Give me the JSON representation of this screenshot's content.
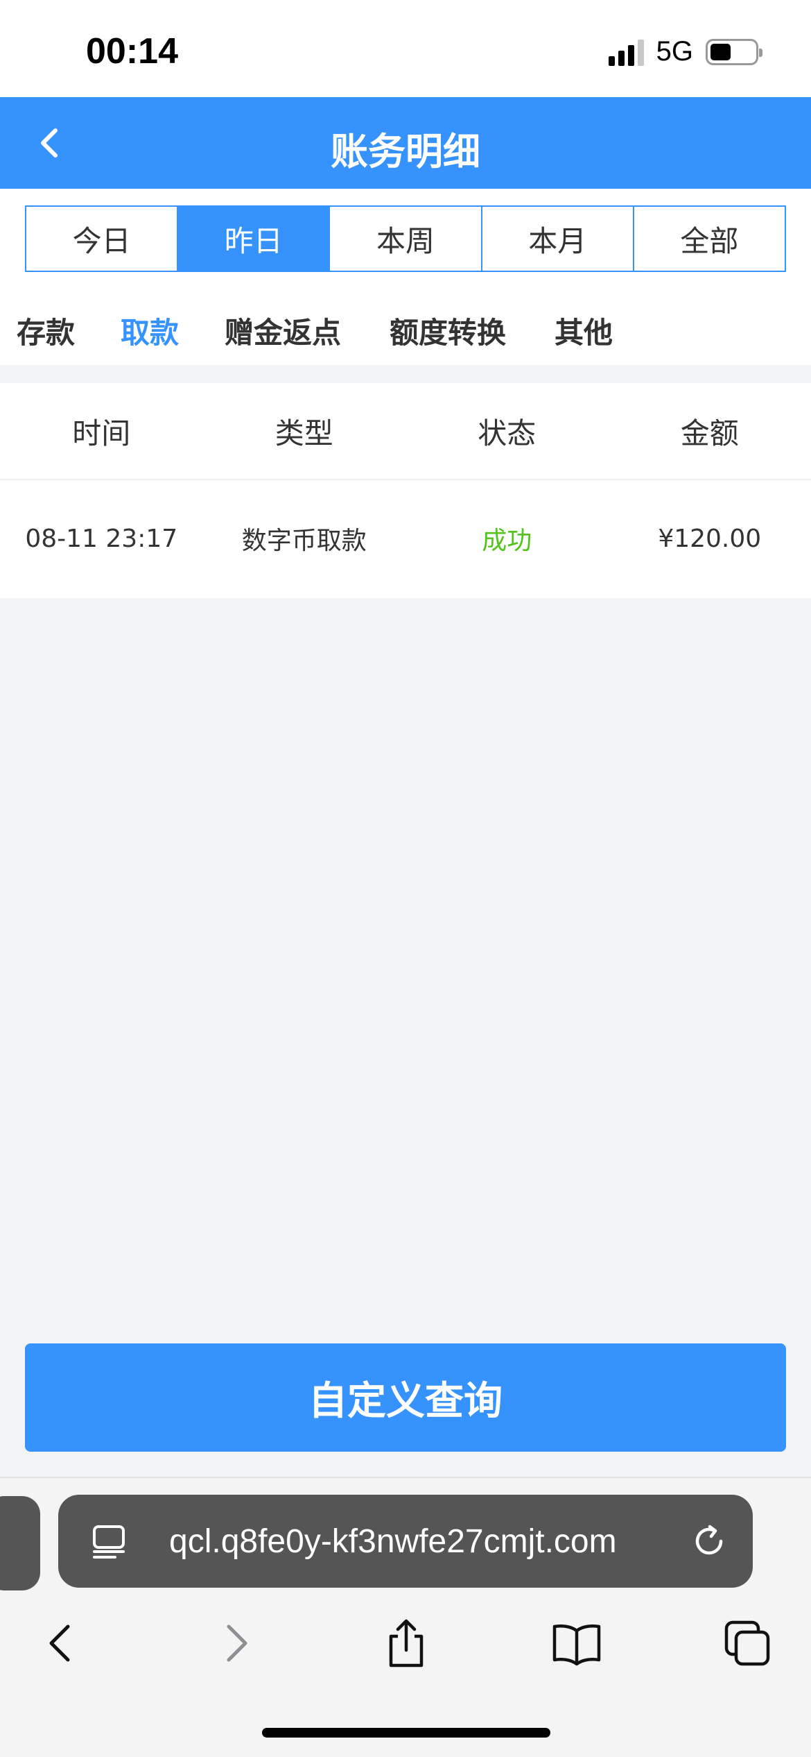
{
  "status_bar": {
    "time": "00:14",
    "network": "5G"
  },
  "nav": {
    "title": "账务明细",
    "back_icon": "chevron-left-icon"
  },
  "date_tabs": [
    {
      "label": "今日",
      "active": false
    },
    {
      "label": "昨日",
      "active": true
    },
    {
      "label": "本周",
      "active": false
    },
    {
      "label": "本月",
      "active": false
    },
    {
      "label": "全部",
      "active": false
    }
  ],
  "type_tabs": [
    {
      "label": "存款",
      "active": false
    },
    {
      "label": "取款",
      "active": true
    },
    {
      "label": "赠金返点",
      "active": false
    },
    {
      "label": "额度转换",
      "active": false
    },
    {
      "label": "其他",
      "active": false
    }
  ],
  "table": {
    "headers": [
      "时间",
      "类型",
      "状态",
      "金额"
    ],
    "rows": [
      {
        "time": "08-11 23:17",
        "type": "数字币取款",
        "status": "成功",
        "amount": "¥120.00"
      }
    ]
  },
  "query_button": {
    "label": "自定义查询"
  },
  "browser": {
    "url": "qcl.q8fe0y-kf3nwfe27cmjt.com",
    "icons": [
      "reader-icon",
      "reload-icon",
      "back-icon",
      "forward-icon",
      "share-icon",
      "bookmarks-icon",
      "tabs-icon"
    ]
  },
  "colors": {
    "accent": "#3693fd",
    "success": "#52c41a",
    "background": "#f3f4f6"
  }
}
